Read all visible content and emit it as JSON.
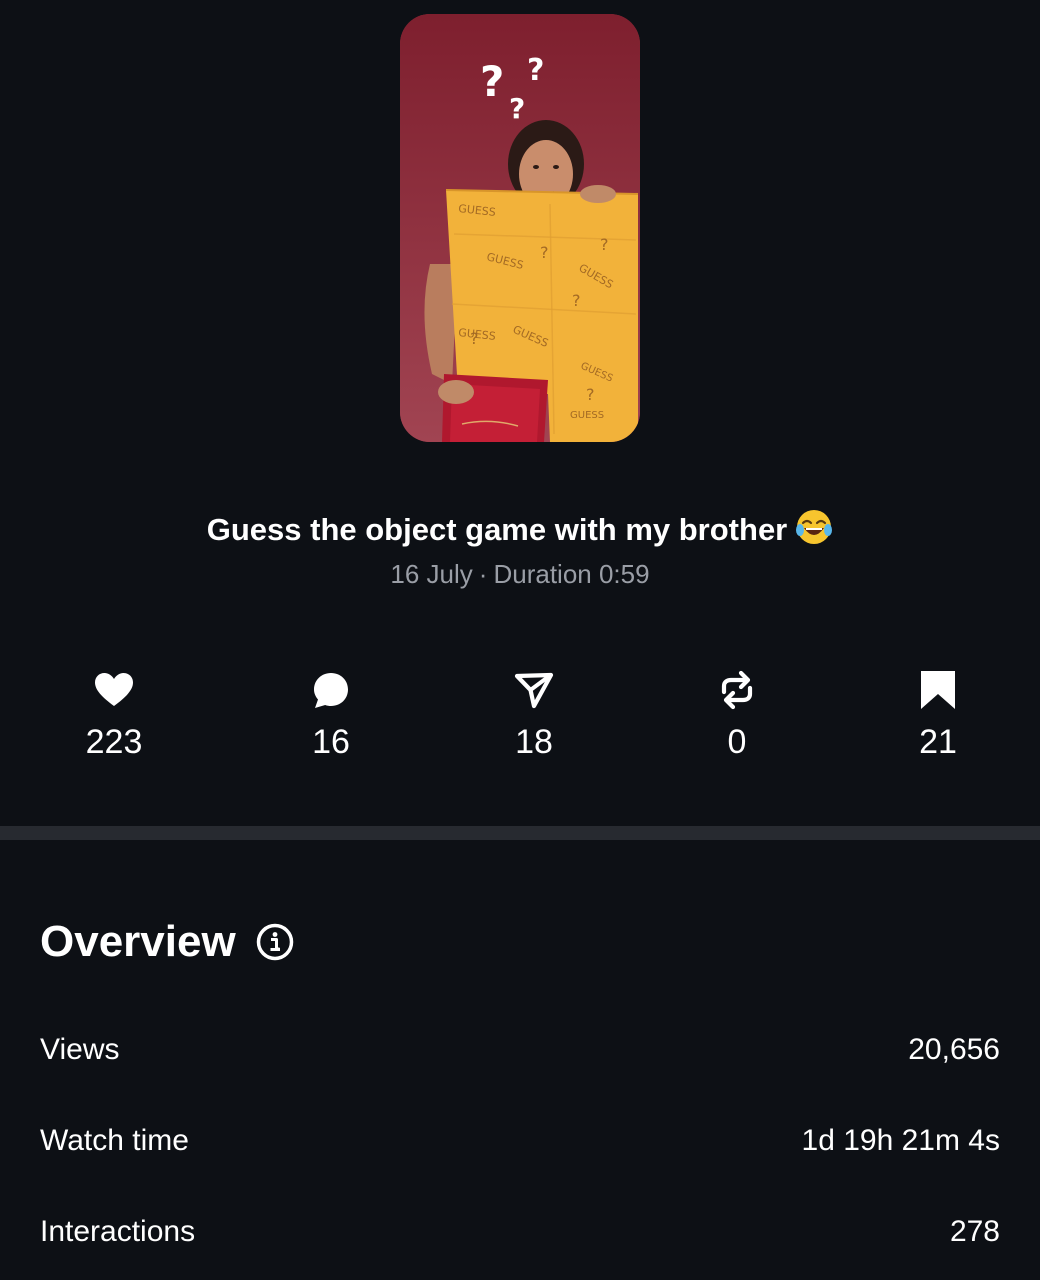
{
  "video": {
    "title": "Guess the object game with my brother",
    "title_emoji": "face-with-tears-of-joy",
    "date": "16 July",
    "separator": "·",
    "duration_label": "Duration 0:59",
    "thumbnail_text": "GUESS"
  },
  "stats": [
    {
      "icon": "heart-icon",
      "value": "223"
    },
    {
      "icon": "comment-icon",
      "value": "16"
    },
    {
      "icon": "share-icon",
      "value": "18"
    },
    {
      "icon": "repost-icon",
      "value": "0"
    },
    {
      "icon": "bookmark-icon",
      "value": "21"
    }
  ],
  "overview": {
    "heading": "Overview",
    "rows": [
      {
        "label": "Views",
        "value": "20,656"
      },
      {
        "label": "Watch time",
        "value": "1d 19h 21m 4s"
      },
      {
        "label": "Interactions",
        "value": "278"
      }
    ]
  },
  "colors": {
    "background": "#0d1015",
    "divider": "#272a30",
    "muted_text": "#9a9ea6",
    "thumbnail_wall": "#8e2f3c",
    "poster_yellow": "#f2b23a"
  }
}
